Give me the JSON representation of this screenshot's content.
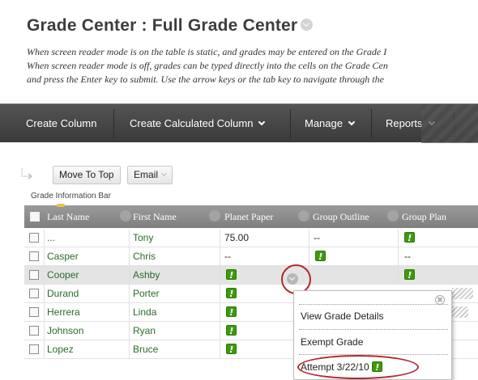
{
  "page": {
    "title": "Grade Center : Full Grade Center",
    "instructions": [
      "When screen reader mode is on the table is static, and grades may be entered on the Grade I",
      "When screen reader mode is off, grades can be typed directly into the cells on the Grade Cen",
      "and press the Enter key to submit. Use the arrow keys or the tab key to navigate through the"
    ]
  },
  "toolbar": {
    "create_column": "Create Column",
    "create_calculated_column": "Create Calculated Column",
    "manage": "Manage",
    "reports": "Reports"
  },
  "actions": {
    "move_to_top": "Move To Top",
    "email": "Email",
    "info_bar_label": "Grade Information Bar"
  },
  "grid": {
    "columns": [
      "Last Name",
      "First Name",
      "Planet Paper",
      "Group Outline",
      "Group Plan"
    ],
    "rows": [
      {
        "last": "...",
        "first": "Tony",
        "paper": "75.00",
        "outline": "--",
        "plan": ""
      },
      {
        "last": "Casper",
        "first": "Chris",
        "paper": "--",
        "outline": "",
        "plan": "--"
      },
      {
        "last": "Cooper",
        "first": "Ashby",
        "paper": "",
        "outline": "",
        "plan": ""
      },
      {
        "last": "Durand",
        "first": "Porter",
        "paper": "",
        "outline": "",
        "plan": ""
      },
      {
        "last": "Herrera",
        "first": "Linda",
        "paper": "",
        "outline": "",
        "plan": ""
      },
      {
        "last": "Johnson",
        "first": "Ryan",
        "paper": "",
        "outline": "",
        "plan": ""
      },
      {
        "last": "Lopez",
        "first": "Bruce",
        "paper": "",
        "outline": "",
        "plan": ""
      }
    ]
  },
  "context_menu": {
    "view_grade_details": "View Grade Details",
    "exempt_grade": "Exempt Grade",
    "attempt": "Attempt 3/22/10"
  },
  "colors": {
    "toolbar_bg": "#454545",
    "grid_header_bg": "#8f8f8f",
    "name_text": "#2b6a2b",
    "needs_grading_icon": "#3d9a0e",
    "annotation_red": "#b3282d"
  },
  "icons": [
    "title-chevron-icon",
    "chevron-down-icon",
    "move-arrow-icon",
    "needs-grading-icon",
    "cell-menu-icon",
    "close-icon"
  ]
}
